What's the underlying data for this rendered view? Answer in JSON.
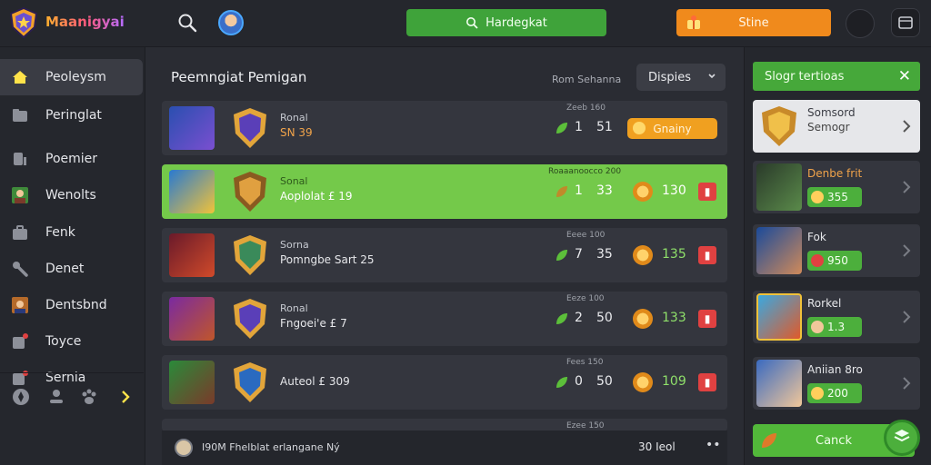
{
  "header": {
    "app_title": "Maanigyai",
    "search_label": "Hardegkat",
    "store_label": "Stine"
  },
  "sidebar": {
    "items": [
      {
        "label": "Peoleysm",
        "icon": "home-icon"
      },
      {
        "label": "Peringlat",
        "icon": "folder-icon"
      },
      {
        "label": "Poemier",
        "icon": "trophy-icon"
      },
      {
        "label": "Wenolts",
        "icon": "avatar-icon"
      },
      {
        "label": "Fenk",
        "icon": "bag-icon"
      },
      {
        "label": "Denet",
        "icon": "wrench-icon"
      },
      {
        "label": "Dentsbnd",
        "icon": "avatar-icon"
      },
      {
        "label": "Toyce",
        "icon": "edit-icon"
      },
      {
        "label": "Sernia",
        "icon": "message-icon"
      }
    ]
  },
  "main": {
    "title": "Peemngiat Pemigan",
    "sort_label": "Rom Sehanna",
    "display_label": "Dispies",
    "rows": [
      {
        "name": "Ronal",
        "sub": "SN 39",
        "tag": "Zeeb 160",
        "n1": "1",
        "n2": "51",
        "action": "Gnainy"
      },
      {
        "name": "Sonal",
        "sub": "Aoplolat £ 19",
        "tag": "Roaaanoocco 200",
        "n1": "1",
        "n2": "33",
        "score": "130"
      },
      {
        "name": "Sorna",
        "sub": "Pomngbe Sart 25",
        "tag": "Eeee 100",
        "n1": "7",
        "n2": "35",
        "score": "135"
      },
      {
        "name": "Ronal",
        "sub": "Fngoei'e £ 7",
        "tag": "Eeze 100",
        "n1": "2",
        "n2": "50",
        "score": "133"
      },
      {
        "name": "",
        "sub": "Auteol £ 309",
        "tag": "Fees 150",
        "n1": "0",
        "n2": "50",
        "score": "109"
      }
    ],
    "partial_row_tag": "Ezee 150",
    "bottom_text": "I90M Fhelblat erlangane Ný",
    "bottom_count": "30 Ieol",
    "bottom_more": "••"
  },
  "panel": {
    "title": "Slogr tertioas",
    "cards": [
      {
        "name": "Somsord",
        "sub": "Semogr"
      },
      {
        "name": "Denbe frit",
        "value": "355"
      },
      {
        "name": "Fok",
        "value": "950"
      },
      {
        "name": "Rorkel",
        "value": "1.3"
      },
      {
        "name": "Aniian 8ro",
        "value": "200"
      }
    ],
    "cancel_label": "Canck"
  }
}
